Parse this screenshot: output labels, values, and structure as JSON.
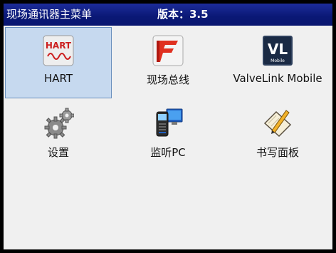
{
  "titlebar": {
    "title": "现场通讯器主菜单",
    "version": "版本：3.5",
    "background": "#0a1875"
  },
  "menu": {
    "items": [
      {
        "label": "HART",
        "icon": "hart-icon",
        "selected": true
      },
      {
        "label": "现场总线",
        "icon": "fieldbus-icon",
        "selected": false
      },
      {
        "label": "ValveLink Mobile",
        "icon": "valvelink-icon",
        "selected": false
      },
      {
        "label": "设置",
        "icon": "gears-icon",
        "selected": false
      },
      {
        "label": "监听PC",
        "icon": "listen-pc-icon",
        "selected": false
      },
      {
        "label": "书写面板",
        "icon": "notepad-icon",
        "selected": false
      }
    ],
    "selected_color": "#c6d9ef",
    "hart_icon_text": "HART",
    "valvelink_icon_text": "VL",
    "valvelink_icon_subtext": "Mobile"
  }
}
